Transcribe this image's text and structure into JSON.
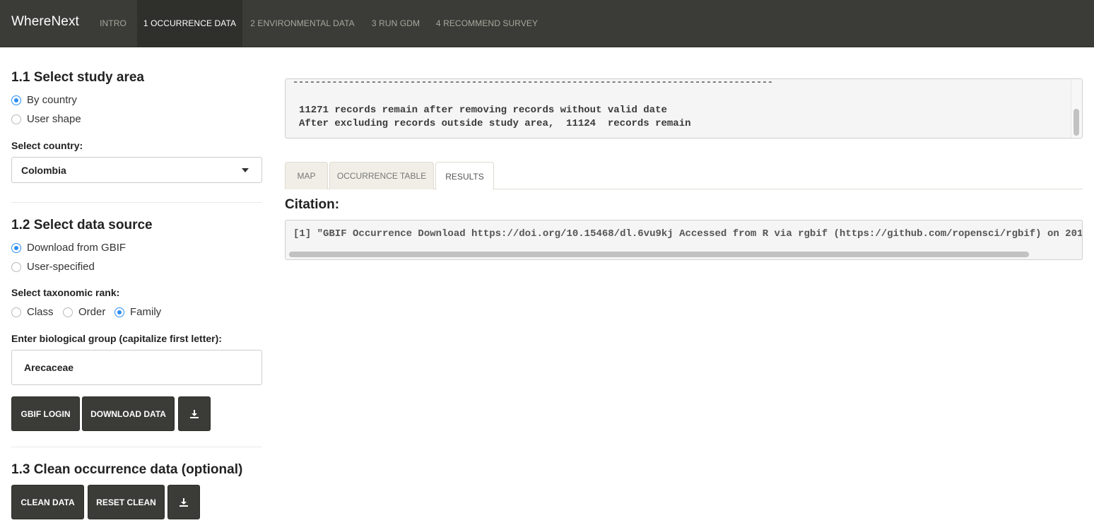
{
  "navbar": {
    "brand": "WhereNext",
    "tabs": [
      {
        "label": "INTRO",
        "active": false
      },
      {
        "label": "1 OCCURRENCE DATA",
        "active": true
      },
      {
        "label": "2 ENVIRONMENTAL DATA",
        "active": false
      },
      {
        "label": "3 RUN GDM",
        "active": false
      },
      {
        "label": "4 RECOMMEND SURVEY",
        "active": false
      }
    ]
  },
  "sidebar": {
    "study_area": {
      "heading": "1.1 Select study area",
      "options": [
        {
          "label": "By country",
          "checked": true
        },
        {
          "label": "User shape",
          "checked": false
        }
      ],
      "country_label": "Select country:",
      "country_value": "Colombia"
    },
    "data_source": {
      "heading": "1.2 Select data source",
      "options": [
        {
          "label": "Download from GBIF",
          "checked": true
        },
        {
          "label": "User-specified",
          "checked": false
        }
      ],
      "rank_label": "Select taxonomic rank:",
      "ranks": [
        {
          "label": "Class",
          "checked": false
        },
        {
          "label": "Order",
          "checked": false
        },
        {
          "label": "Family",
          "checked": true
        }
      ],
      "group_label": "Enter biological group (capitalize first letter):",
      "group_value": "Arecaceae",
      "buttons": {
        "login": "GBIF LOGIN",
        "download": "DOWNLOAD DATA",
        "save_icon": "download-icon"
      }
    },
    "clean": {
      "heading": "1.3 Clean occurrence data (optional)",
      "buttons": {
        "clean": "CLEAN DATA",
        "reset": "RESET CLEAN",
        "save_icon": "download-icon"
      }
    }
  },
  "main": {
    "console": {
      "separator": "--------------------------------------------------------------------------------------",
      "lines": [
        "11271 records remain after removing records without valid date",
        "After excluding records outside study area,  11124  records remain"
      ]
    },
    "tabs": [
      {
        "label": "MAP",
        "active": false
      },
      {
        "label": "OCCURRENCE TABLE",
        "active": false
      },
      {
        "label": "RESULTS",
        "active": true
      }
    ],
    "citation_heading": "Citation:",
    "citation_text": "[1] \"GBIF Occurrence Download https://doi.org/10.15468/dl.6vu9kj Accessed from R via rgbif (https://github.com/ropensci/rgbif) on 201"
  },
  "colors": {
    "navbar_bg": "#3b3b37",
    "button_bg": "#3b3b37",
    "radio_accent": "#2d8ef0"
  }
}
